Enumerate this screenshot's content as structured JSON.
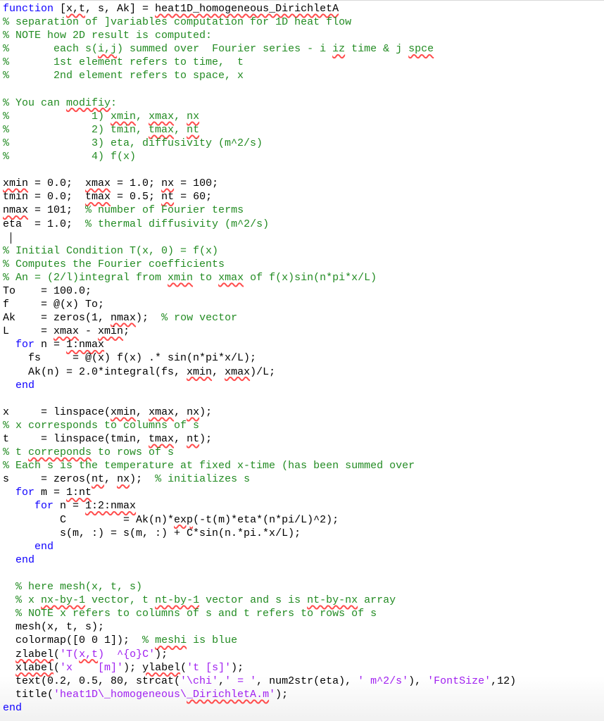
{
  "editor": {
    "language": "MATLAB",
    "function_name": "heat1D_homogeneous_DirichletA",
    "lines": [
      [
        {
          "t": "function",
          "c": "kw"
        },
        {
          "t": " ["
        },
        {
          "t": "x,t",
          "c": "sq"
        },
        {
          "t": ", s, Ak] = "
        },
        {
          "t": "heat1D_homogeneous_DirichletA",
          "c": "sq"
        }
      ],
      [
        {
          "t": "% separation of ]variables computation for 1D heat flow",
          "c": "cm"
        }
      ],
      [
        {
          "t": "% NOTE how 2D result is computed:",
          "c": "cm"
        }
      ],
      [
        {
          "t": "%       each s(",
          "c": "cm"
        },
        {
          "t": "i,j",
          "c": "cm sq"
        },
        {
          "t": ") summed over  Fourier series - i ",
          "c": "cm"
        },
        {
          "t": "iz",
          "c": "cm sq"
        },
        {
          "t": " time & j ",
          "c": "cm"
        },
        {
          "t": "spce",
          "c": "cm sq"
        }
      ],
      [
        {
          "t": "%       1st element refers to time,  t",
          "c": "cm"
        }
      ],
      [
        {
          "t": "%       2nd element refers to space, x",
          "c": "cm"
        }
      ],
      [],
      [
        {
          "t": "% You can ",
          "c": "cm"
        },
        {
          "t": "modifiy",
          "c": "cm sq"
        },
        {
          "t": ":",
          "c": "cm"
        }
      ],
      [
        {
          "t": "%             1) ",
          "c": "cm"
        },
        {
          "t": "xmin",
          "c": "cm sq"
        },
        {
          "t": ", ",
          "c": "cm"
        },
        {
          "t": "xmax",
          "c": "cm sq"
        },
        {
          "t": ", ",
          "c": "cm"
        },
        {
          "t": "nx",
          "c": "cm sq"
        }
      ],
      [
        {
          "t": "%             2) tmin, ",
          "c": "cm"
        },
        {
          "t": "tmax",
          "c": "cm sq"
        },
        {
          "t": ", ",
          "c": "cm"
        },
        {
          "t": "nt",
          "c": "cm sq"
        }
      ],
      [
        {
          "t": "%             3) eta, diffusivity (m^2/s)",
          "c": "cm"
        }
      ],
      [
        {
          "t": "%             4) f(x)",
          "c": "cm"
        }
      ],
      [],
      [
        {
          "t": "xmin",
          "c": "sq"
        },
        {
          "t": " = 0.0;  "
        },
        {
          "t": "xmax",
          "c": "sq"
        },
        {
          "t": " = 1.0; "
        },
        {
          "t": "nx",
          "c": "sq"
        },
        {
          "t": " = 100;"
        }
      ],
      [
        {
          "t": "tmin = 0.0;  "
        },
        {
          "t": "tmax",
          "c": "sq"
        },
        {
          "t": " = 0.5; "
        },
        {
          "t": "nt",
          "c": "sq"
        },
        {
          "t": " = 60;"
        }
      ],
      [
        {
          "t": "nmax",
          "c": "sq"
        },
        {
          "t": " = 101;  "
        },
        {
          "t": "% number of Fourier terms",
          "c": "cm"
        }
      ],
      [
        {
          "t": "eta  = 1.0;  "
        },
        {
          "t": "% thermal diffusivity (m^2/s)",
          "c": "cm"
        }
      ],
      [
        {
          "cursor": true
        }
      ],
      [
        {
          "t": "% Initial Condition T(x, 0) = f(x)",
          "c": "cm"
        }
      ],
      [
        {
          "t": "% Computes the Fourier coefficients",
          "c": "cm"
        }
      ],
      [
        {
          "t": "% An = (2/l)integral from ",
          "c": "cm"
        },
        {
          "t": "xmin",
          "c": "cm sq"
        },
        {
          "t": " to ",
          "c": "cm"
        },
        {
          "t": "xmax",
          "c": "cm sq"
        },
        {
          "t": " of f(x)sin(n*pi*x/L)",
          "c": "cm"
        }
      ],
      [
        {
          "t": "To    = 100.0;"
        }
      ],
      [
        {
          "t": "f     = @(x) To;"
        }
      ],
      [
        {
          "t": "Ak    = zeros(1, "
        },
        {
          "t": "nmax",
          "c": "sq"
        },
        {
          "t": ");  "
        },
        {
          "t": "% row vector",
          "c": "cm"
        }
      ],
      [
        {
          "t": "L     = "
        },
        {
          "t": "xmax",
          "c": "sq"
        },
        {
          "t": " - "
        },
        {
          "t": "xmin",
          "c": "sq"
        },
        {
          "t": ";"
        }
      ],
      [
        {
          "t": "  "
        },
        {
          "t": "for",
          "c": "kw"
        },
        {
          "t": " n = "
        },
        {
          "t": "1:nmax",
          "c": "sq"
        }
      ],
      [
        {
          "t": "    fs     = @(x) f(x) .* sin(n*pi*x/L);"
        }
      ],
      [
        {
          "t": "    Ak(n) = 2.0*integral(fs, "
        },
        {
          "t": "xmin",
          "c": "sq"
        },
        {
          "t": ", "
        },
        {
          "t": "xmax",
          "c": "sq"
        },
        {
          "t": ")/L;"
        }
      ],
      [
        {
          "t": "  "
        },
        {
          "t": "end",
          "c": "kw"
        }
      ],
      [],
      [
        {
          "t": "x     = linspace("
        },
        {
          "t": "xmin",
          "c": "sq"
        },
        {
          "t": ", "
        },
        {
          "t": "xmax",
          "c": "sq"
        },
        {
          "t": ", "
        },
        {
          "t": "nx",
          "c": "sq"
        },
        {
          "t": ");"
        }
      ],
      [
        {
          "t": "% x corresponds to columns of s",
          "c": "cm"
        }
      ],
      [
        {
          "t": "t     = linspace(tmin, "
        },
        {
          "t": "tmax",
          "c": "sq"
        },
        {
          "t": ", "
        },
        {
          "t": "nt",
          "c": "sq"
        },
        {
          "t": ");"
        }
      ],
      [
        {
          "t": "% t ",
          "c": "cm"
        },
        {
          "t": "correponds",
          "c": "cm sq"
        },
        {
          "t": " to rows of s",
          "c": "cm"
        }
      ],
      [
        {
          "t": "% Each s is the temperature at fixed x-time (has been summed over",
          "c": "cm"
        }
      ],
      [
        {
          "t": "s     = zeros("
        },
        {
          "t": "nt",
          "c": "sq"
        },
        {
          "t": ", "
        },
        {
          "t": "nx",
          "c": "sq"
        },
        {
          "t": ");  "
        },
        {
          "t": "% initializes s",
          "c": "cm"
        }
      ],
      [
        {
          "t": "  "
        },
        {
          "t": "for",
          "c": "kw"
        },
        {
          "t": " m = "
        },
        {
          "t": "1:nt",
          "c": "sq"
        }
      ],
      [
        {
          "t": "     "
        },
        {
          "t": "for",
          "c": "kw"
        },
        {
          "t": " n = "
        },
        {
          "t": "1:2:nmax",
          "c": "sq"
        }
      ],
      [
        {
          "t": "         C         = Ak(n)*"
        },
        {
          "t": "exp",
          "c": "sq"
        },
        {
          "t": "(-t(m)*eta*(n*pi/L)^2);"
        }
      ],
      [
        {
          "t": "         s(m, :) = s(m, :) + C*sin(n.*pi.*x/L);"
        }
      ],
      [
        {
          "t": "     "
        },
        {
          "t": "end",
          "c": "kw"
        }
      ],
      [
        {
          "t": "  "
        },
        {
          "t": "end",
          "c": "kw"
        }
      ],
      [],
      [
        {
          "t": "  % here mesh(x, t, s)",
          "c": "cm"
        }
      ],
      [
        {
          "t": "  % x ",
          "c": "cm"
        },
        {
          "t": "nx-by-1",
          "c": "cm sq"
        },
        {
          "t": " vector, t ",
          "c": "cm"
        },
        {
          "t": "nt-by-1",
          "c": "cm sq"
        },
        {
          "t": " vector and s is ",
          "c": "cm"
        },
        {
          "t": "nt-by-nx",
          "c": "cm sq"
        },
        {
          "t": " array",
          "c": "cm"
        }
      ],
      [
        {
          "t": "  % NOTE x refers to columns of s and t refers to rows of s",
          "c": "cm"
        }
      ],
      [
        {
          "t": "  mesh(x, t, s);"
        }
      ],
      [
        {
          "t": "  colormap([0 0 1]);  "
        },
        {
          "t": "% ",
          "c": "cm"
        },
        {
          "t": "meshi",
          "c": "cm sq"
        },
        {
          "t": " is blue",
          "c": "cm"
        }
      ],
      [
        {
          "t": "  "
        },
        {
          "t": "zlabel",
          "c": "sq"
        },
        {
          "t": "("
        },
        {
          "t": "'T(",
          "c": "str"
        },
        {
          "t": "x,t",
          "c": "str sq"
        },
        {
          "t": ")  ^{o}C'",
          "c": "str"
        },
        {
          "t": ");"
        }
      ],
      [
        {
          "t": "  "
        },
        {
          "t": "xlabel",
          "c": "sq"
        },
        {
          "t": "("
        },
        {
          "t": "'x    [m]'",
          "c": "str"
        },
        {
          "t": "); "
        },
        {
          "t": "ylabel",
          "c": "sq"
        },
        {
          "t": "("
        },
        {
          "t": "'t [s]'",
          "c": "str"
        },
        {
          "t": ");"
        }
      ],
      [
        {
          "t": "  text(0.2, 0.5, 80, strcat("
        },
        {
          "t": "'\\chi'",
          "c": "str"
        },
        {
          "t": ","
        },
        {
          "t": "' = '",
          "c": "str"
        },
        {
          "t": ", num2str(eta), "
        },
        {
          "t": "' m^2/s'",
          "c": "str"
        },
        {
          "t": "), "
        },
        {
          "t": "'FontSize'",
          "c": "str"
        },
        {
          "t": ",12)"
        }
      ],
      [
        {
          "t": "  title("
        },
        {
          "t": "'heat1D\\_homogeneous\\",
          "c": "str"
        },
        {
          "t": "_DirichletA.m",
          "c": "str sq"
        },
        {
          "t": "'",
          "c": "str"
        },
        {
          "t": ");"
        }
      ],
      [
        {
          "t": "end",
          "c": "kw"
        }
      ]
    ]
  },
  "colors": {
    "keyword": "#0e00ff",
    "comment": "#228b22",
    "string": "#a020f0",
    "squiggle": "#ff4d4d"
  }
}
